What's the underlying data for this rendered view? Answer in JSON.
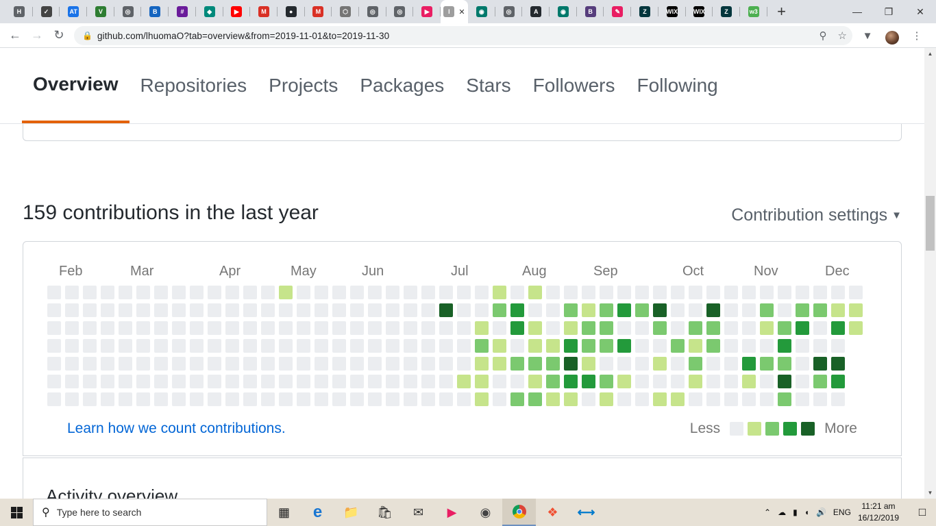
{
  "browser": {
    "tabs": [
      {
        "icon": "h-square-icon",
        "color": "#5f6368",
        "glyph": "H"
      },
      {
        "icon": "json-icon",
        "color": "#444444",
        "glyph": "✓"
      },
      {
        "icon": "at-icon",
        "color": "#1a73e8",
        "glyph": "AT"
      },
      {
        "icon": "vue-icon",
        "color": "#2e7d32",
        "glyph": "V"
      },
      {
        "icon": "globe-icon",
        "color": "#5f6368",
        "glyph": "◎"
      },
      {
        "icon": "bootstrap-icon",
        "color": "#1565c0",
        "glyph": "B"
      },
      {
        "icon": "grid-icon",
        "color": "#6a1b9a",
        "glyph": "#"
      },
      {
        "icon": "diamond-icon",
        "color": "#00897b",
        "glyph": "◆"
      },
      {
        "icon": "youtube-icon",
        "color": "#ff0000",
        "glyph": "▶"
      },
      {
        "icon": "gmail-icon",
        "color": "#d93025",
        "glyph": "M"
      },
      {
        "icon": "github-icon",
        "color": "#24292e",
        "glyph": "●"
      },
      {
        "icon": "gmail-icon",
        "color": "#d93025",
        "glyph": "M"
      },
      {
        "icon": "cube-icon",
        "color": "#757575",
        "glyph": "⬡"
      },
      {
        "icon": "globe-icon",
        "color": "#5f6368",
        "glyph": "◎"
      },
      {
        "icon": "globe-icon",
        "color": "#5f6368",
        "glyph": "◎"
      },
      {
        "icon": "play-circle-icon",
        "color": "#e91e63",
        "glyph": "▶"
      },
      {
        "icon": "page-icon",
        "color": "#9e9e9e",
        "glyph": "I"
      },
      {
        "icon": "eye-icon",
        "color": "#00796b",
        "glyph": "◉"
      },
      {
        "icon": "globe-icon",
        "color": "#5f6368",
        "glyph": "◎"
      },
      {
        "icon": "angular-icon",
        "color": "#24292e",
        "glyph": "A"
      },
      {
        "icon": "eye-icon",
        "color": "#00796b",
        "glyph": "◉"
      },
      {
        "icon": "bootstrap-icon",
        "color": "#563d7c",
        "glyph": "B"
      },
      {
        "icon": "signature-icon",
        "color": "#e91e63",
        "glyph": "✎"
      },
      {
        "icon": "zendesk-icon",
        "color": "#03363d",
        "glyph": "Z"
      },
      {
        "icon": "wix-icon",
        "color": "#000000",
        "glyph": "WIX"
      },
      {
        "icon": "wix-icon",
        "color": "#000000",
        "glyph": "WIX"
      },
      {
        "icon": "zendesk-icon",
        "color": "#03363d",
        "glyph": "Z"
      },
      {
        "icon": "w3schools-icon",
        "color": "#4caf50",
        "glyph": "w3"
      }
    ],
    "active_tab_index": 16,
    "url": "github.com/lhuomaO?tab=overview&from=2019-11-01&to=2019-11-30"
  },
  "profile_nav": [
    "Overview",
    "Repositories",
    "Projects",
    "Packages",
    "Stars",
    "Followers",
    "Following"
  ],
  "contributions": {
    "title": "159 contributions in the last year",
    "settings_label": "Contribution settings",
    "months": [
      {
        "label": "Feb",
        "week": 1
      },
      {
        "label": "Mar",
        "week": 5
      },
      {
        "label": "Apr",
        "week": 10
      },
      {
        "label": "May",
        "week": 14
      },
      {
        "label": "Jun",
        "week": 18
      },
      {
        "label": "Jul",
        "week": 23
      },
      {
        "label": "Aug",
        "week": 27
      },
      {
        "label": "Sep",
        "week": 31
      },
      {
        "label": "Oct",
        "week": 36
      },
      {
        "label": "Nov",
        "week": 40
      },
      {
        "label": "Dec",
        "week": 44
      }
    ],
    "colors": [
      "#ebedf0",
      "#c6e48b",
      "#7bc96f",
      "#239a3b",
      "#196127"
    ],
    "weeks": [
      [
        0,
        0,
        0,
        0,
        0,
        0,
        0
      ],
      [
        0,
        0,
        0,
        0,
        0,
        0,
        0
      ],
      [
        0,
        0,
        0,
        0,
        0,
        0,
        0
      ],
      [
        0,
        0,
        0,
        0,
        0,
        0,
        0
      ],
      [
        0,
        0,
        0,
        0,
        0,
        0,
        0
      ],
      [
        0,
        0,
        0,
        0,
        0,
        0,
        0
      ],
      [
        0,
        0,
        0,
        0,
        0,
        0,
        0
      ],
      [
        0,
        0,
        0,
        0,
        0,
        0,
        0
      ],
      [
        0,
        0,
        0,
        0,
        0,
        0,
        0
      ],
      [
        0,
        0,
        0,
        0,
        0,
        0,
        0
      ],
      [
        0,
        0,
        0,
        0,
        0,
        0,
        0
      ],
      [
        0,
        0,
        0,
        0,
        0,
        0,
        0
      ],
      [
        0,
        0,
        0,
        0,
        0,
        0,
        0
      ],
      [
        1,
        0,
        0,
        0,
        0,
        0,
        0
      ],
      [
        0,
        0,
        0,
        0,
        0,
        0,
        0
      ],
      [
        0,
        0,
        0,
        0,
        0,
        0,
        0
      ],
      [
        0,
        0,
        0,
        0,
        0,
        0,
        0
      ],
      [
        0,
        0,
        0,
        0,
        0,
        0,
        0
      ],
      [
        0,
        0,
        0,
        0,
        0,
        0,
        0
      ],
      [
        0,
        0,
        0,
        0,
        0,
        0,
        0
      ],
      [
        0,
        0,
        0,
        0,
        0,
        0,
        0
      ],
      [
        0,
        0,
        0,
        0,
        0,
        0,
        0
      ],
      [
        0,
        4,
        0,
        0,
        0,
        0,
        0
      ],
      [
        0,
        0,
        0,
        0,
        0,
        1,
        0
      ],
      [
        0,
        0,
        1,
        2,
        1,
        1,
        1
      ],
      [
        1,
        2,
        0,
        1,
        1,
        0,
        0
      ],
      [
        0,
        3,
        3,
        0,
        2,
        0,
        2
      ],
      [
        1,
        0,
        1,
        1,
        2,
        1,
        2
      ],
      [
        0,
        0,
        0,
        1,
        2,
        2,
        1
      ],
      [
        0,
        2,
        1,
        3,
        4,
        3,
        1
      ],
      [
        0,
        1,
        2,
        2,
        1,
        3,
        0
      ],
      [
        0,
        2,
        2,
        2,
        0,
        2,
        1
      ],
      [
        0,
        3,
        0,
        3,
        0,
        1,
        0
      ],
      [
        0,
        2,
        0,
        0,
        0,
        0,
        0
      ],
      [
        0,
        4,
        2,
        0,
        1,
        0,
        1
      ],
      [
        0,
        0,
        0,
        2,
        0,
        0,
        1
      ],
      [
        0,
        0,
        2,
        1,
        2,
        1,
        0
      ],
      [
        0,
        4,
        2,
        2,
        0,
        0,
        0
      ],
      [
        0,
        0,
        0,
        0,
        0,
        0,
        0
      ],
      [
        0,
        0,
        0,
        0,
        3,
        1,
        0
      ],
      [
        0,
        2,
        1,
        0,
        2,
        0,
        0
      ],
      [
        0,
        0,
        2,
        3,
        2,
        4,
        2
      ],
      [
        0,
        2,
        3,
        0,
        0,
        0,
        0
      ],
      [
        0,
        2,
        0,
        0,
        4,
        2,
        0
      ],
      [
        0,
        1,
        3,
        0,
        4,
        3,
        0
      ],
      [
        0,
        1,
        1,
        null,
        null,
        null,
        null
      ]
    ],
    "learn_link": "Learn how we count contributions.",
    "legend_less": "Less",
    "legend_more": "More"
  },
  "activity": {
    "title": "Activity overview"
  },
  "taskbar": {
    "search_placeholder": "Type here to search",
    "language": "ENG",
    "time": "11:21 am",
    "date": "16/12/2019"
  }
}
